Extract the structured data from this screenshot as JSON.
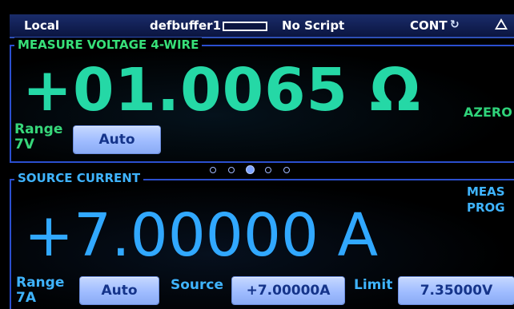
{
  "status_bar": {
    "local": "Local",
    "buffer": "defbuffer1",
    "script": "No Script",
    "trigger_mode": "CONT",
    "trigger_icon": "refresh-icon",
    "warning_icon": "warning-triangle-icon"
  },
  "measure": {
    "title": "MEASURE VOLTAGE 4-WIRE",
    "reading": "+01.0065 Ω",
    "azero": "AZERO",
    "range_label": "Range",
    "range_value": "7V",
    "range_button": "Auto"
  },
  "page_dots": {
    "count": 5,
    "active": 3
  },
  "source": {
    "title": "SOURCE CURRENT",
    "reading": "+7.00000 A",
    "meas_line1": "MEAS",
    "meas_line2": "PROG",
    "range_label": "Range",
    "range_value": "7A",
    "range_button": "Auto",
    "level_label": "Source",
    "level_button": "+7.00000A",
    "limit_label": "Limit",
    "limit_button": "7.35000V"
  },
  "colors": {
    "measure_accent": "#25d8a6",
    "source_accent": "#31a8ff",
    "status_bar": "#1a2c6a",
    "button": "#9fbcff"
  }
}
